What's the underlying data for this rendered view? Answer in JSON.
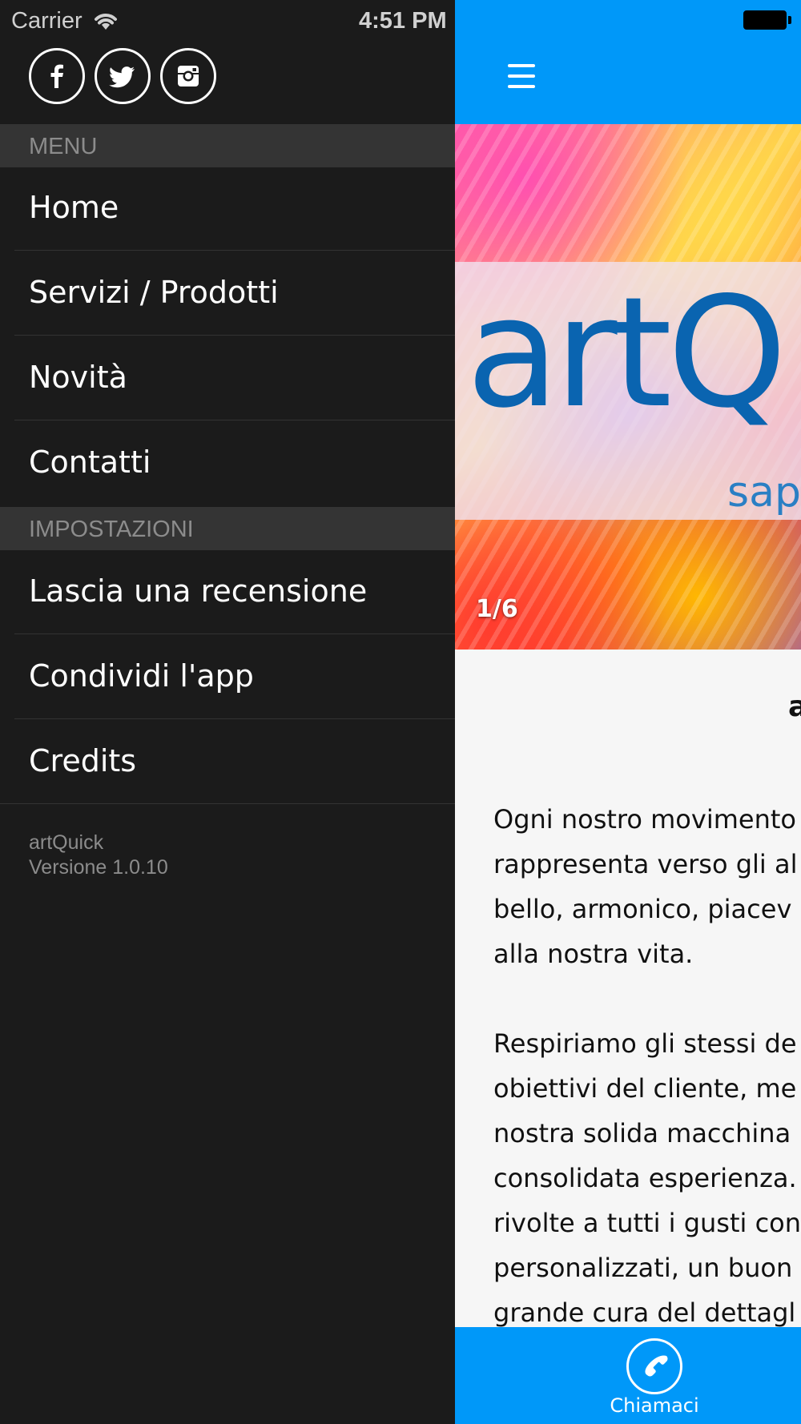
{
  "status_bar": {
    "carrier": "Carrier",
    "time": "4:51 PM"
  },
  "drawer": {
    "social": [
      {
        "name": "facebook-icon"
      },
      {
        "name": "twitter-icon"
      },
      {
        "name": "instagram-icon"
      }
    ],
    "sections": {
      "menu": "MENU",
      "settings": "IMPOSTAZIONI"
    },
    "menu_items": [
      {
        "label": "Home"
      },
      {
        "label": "Servizi / Prodotti"
      },
      {
        "label": "Novità"
      },
      {
        "label": "Contatti"
      }
    ],
    "settings_items": [
      {
        "label": "Lascia una recensione"
      },
      {
        "label": "Condividi l'app"
      },
      {
        "label": "Credits"
      }
    ],
    "footer": {
      "app_name": "artQuick",
      "version": "Versione 1.0.10"
    }
  },
  "main": {
    "slider": {
      "logo_text": "artQ",
      "logo_sub": "sap",
      "counter": "1/6"
    },
    "title": "a",
    "paragraphs": [
      [
        "Ogni nostro movimento",
        "rappresenta verso gli al",
        "bello, armonico, piacev",
        "alla nostra vita."
      ],
      [
        "Respiriamo gli stessi de",
        "obiettivi del cliente, me",
        "nostra solida macchina",
        "consolidata esperienza.",
        "rivolte a tutti i gusti con",
        "personalizzati, un buon",
        "grande cura del dettagl"
      ]
    ],
    "bottom_bar": {
      "call_label": "Chiamaci"
    }
  },
  "colors": {
    "accent": "#0098f9",
    "drawer_bg": "#1b1b1b",
    "section_bg": "#343434",
    "logo_blue": "#0a64b0"
  }
}
